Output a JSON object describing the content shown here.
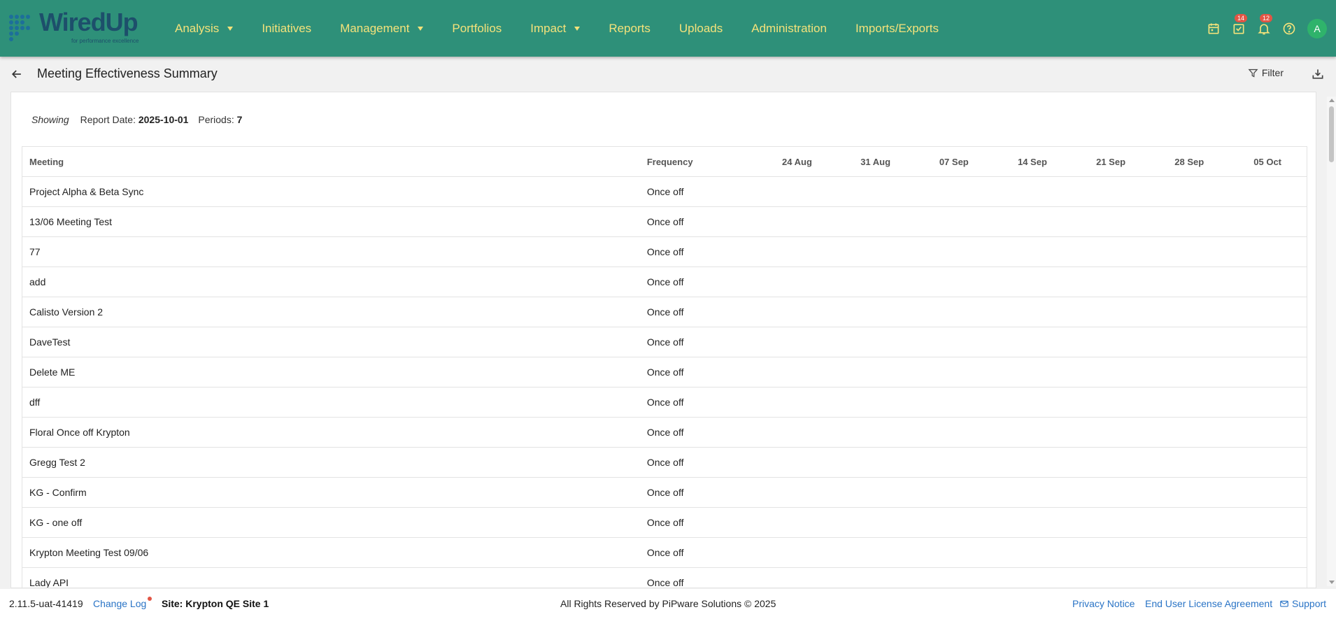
{
  "header": {
    "logo_text": "WiredUp",
    "logo_tagline": "for performance excellence",
    "nav": [
      {
        "label": "Analysis",
        "dropdown": true
      },
      {
        "label": "Initiatives",
        "dropdown": false
      },
      {
        "label": "Management",
        "dropdown": true
      },
      {
        "label": "Portfolios",
        "dropdown": false
      },
      {
        "label": "Impact",
        "dropdown": true
      },
      {
        "label": "Reports",
        "dropdown": false
      },
      {
        "label": "Uploads",
        "dropdown": false
      },
      {
        "label": "Administration",
        "dropdown": false
      },
      {
        "label": "Imports/Exports",
        "dropdown": false
      }
    ],
    "tasks_badge": "14",
    "notifications_badge": "12",
    "avatar_initial": "A",
    "icons": [
      "calendar-icon",
      "task-check-icon",
      "bell-icon",
      "help-icon"
    ]
  },
  "page": {
    "title": "Meeting Effectiveness Summary",
    "filter_label": "Filter"
  },
  "summary": {
    "showing_label": "Showing",
    "report_date_label": "Report Date:",
    "report_date": "2025-10-01",
    "periods_label": "Periods:",
    "periods": "7"
  },
  "table": {
    "columns": [
      "Meeting",
      "Frequency",
      "24 Aug",
      "31 Aug",
      "07 Sep",
      "14 Sep",
      "21 Sep",
      "28 Sep",
      "05 Oct"
    ],
    "rows": [
      {
        "meeting": "Project Alpha & Beta Sync",
        "frequency": "Once off"
      },
      {
        "meeting": "13/06 Meeting Test",
        "frequency": "Once off"
      },
      {
        "meeting": "77",
        "frequency": "Once off"
      },
      {
        "meeting": "add",
        "frequency": "Once off"
      },
      {
        "meeting": "Calisto Version 2",
        "frequency": "Once off"
      },
      {
        "meeting": "DaveTest",
        "frequency": "Once off"
      },
      {
        "meeting": "Delete ME",
        "frequency": "Once off"
      },
      {
        "meeting": "dff",
        "frequency": "Once off"
      },
      {
        "meeting": "Floral Once off Krypton",
        "frequency": "Once off"
      },
      {
        "meeting": "Gregg Test 2",
        "frequency": "Once off"
      },
      {
        "meeting": "KG - Confirm",
        "frequency": "Once off"
      },
      {
        "meeting": "KG - one off",
        "frequency": "Once off"
      },
      {
        "meeting": "Krypton Meeting Test 09/06",
        "frequency": "Once off"
      },
      {
        "meeting": "Lady API",
        "frequency": "Once off"
      }
    ]
  },
  "footer": {
    "version": "2.11.5-uat-41419",
    "change_log": "Change Log",
    "site": "Site: Krypton QE Site 1",
    "rights": "All Rights Reserved by PiPware Solutions © 2025",
    "privacy": "Privacy Notice",
    "eula": "End User License Agreement",
    "support": "Support"
  },
  "colors": {
    "topbar": "#2e9079",
    "nav_text": "#f4e27a",
    "link": "#2a74c6",
    "badge": "#e25545",
    "avatar": "#2fb36b"
  }
}
